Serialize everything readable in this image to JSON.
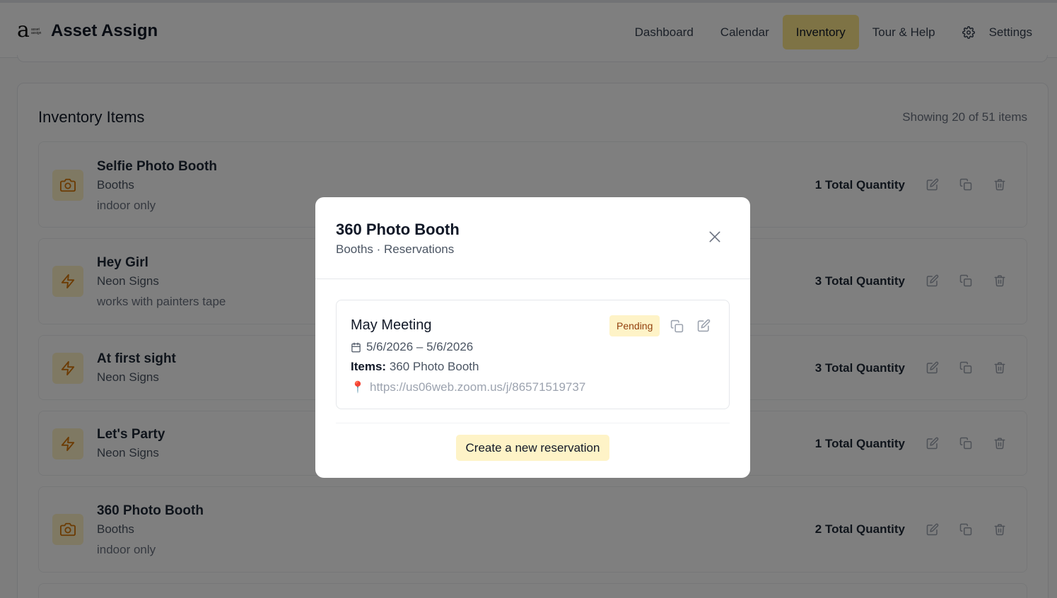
{
  "app": {
    "name": "Asset Assign",
    "logo_letter": "a",
    "logo_tagline": "asset assign"
  },
  "nav": {
    "items": [
      {
        "label": "Dashboard",
        "active": false
      },
      {
        "label": "Calendar",
        "active": false
      },
      {
        "label": "Inventory",
        "active": true
      },
      {
        "label": "Tour & Help",
        "active": false
      },
      {
        "label": "Settings",
        "active": false,
        "icon": "gear-icon"
      }
    ]
  },
  "inventory": {
    "title": "Inventory Items",
    "count_text": "Showing 20 of 51 items",
    "items": [
      {
        "name": "Selfie Photo Booth",
        "category": "Booths",
        "note": "indoor only",
        "quantity": "1 Total Quantity",
        "icon": "camera-icon"
      },
      {
        "name": "Hey Girl",
        "category": "Neon Signs",
        "note": "works with painters tape",
        "quantity": "3 Total Quantity",
        "icon": "lightning-icon"
      },
      {
        "name": "At first sight",
        "category": "Neon Signs",
        "note": "",
        "quantity": "3 Total Quantity",
        "icon": "lightning-icon"
      },
      {
        "name": "Let's Party",
        "category": "Neon Signs",
        "note": "",
        "quantity": "1 Total Quantity",
        "icon": "lightning-icon"
      },
      {
        "name": "360 Photo Booth",
        "category": "Booths",
        "note": "indoor only",
        "quantity": "2 Total Quantity",
        "icon": "camera-icon"
      }
    ]
  },
  "modal": {
    "title": "360 Photo Booth",
    "subtitle": "Booths · Reservations",
    "reservation": {
      "title": "May Meeting",
      "status": "Pending",
      "dates": "5/6/2026 – 5/6/2026",
      "items_label": "Items:",
      "items_value": "360 Photo Booth",
      "location": "https://us06web.zoom.us/j/86571519737"
    },
    "create_label": "Create a new reservation"
  },
  "colors": {
    "accent": "#fde68a",
    "accent_light": "#fef3c7",
    "icon": "#d97706",
    "badge_text": "#92400e"
  }
}
